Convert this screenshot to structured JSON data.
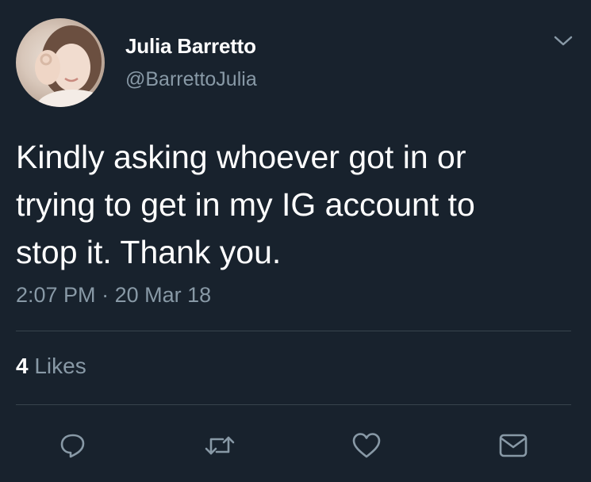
{
  "tweet": {
    "author": {
      "display_name": "Julia Barretto",
      "handle": "@BarrettoJulia"
    },
    "text": "Kindly asking whoever got in or\ntrying to get in my IG account to\nstop it. Thank you.",
    "time": "2:07 PM",
    "separator": " · ",
    "date": "20 Mar 18",
    "likes": {
      "count": "4",
      "label": " Likes"
    }
  },
  "icons": {
    "menu": "chevron-down-icon",
    "reply": "reply-icon",
    "retweet": "retweet-icon",
    "like": "heart-icon",
    "message": "envelope-icon"
  },
  "colors": {
    "background": "#18222d",
    "text_primary": "#ffffff",
    "text_secondary": "#8899a6",
    "divider": "#38444d"
  }
}
